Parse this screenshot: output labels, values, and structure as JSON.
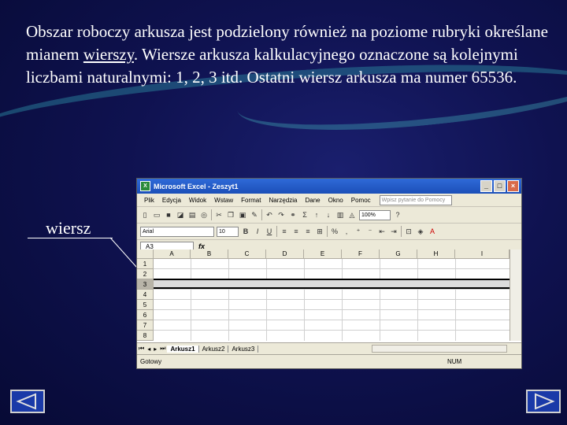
{
  "paragraph": {
    "part1": "Obszar roboczy arkusza jest podzielony również na poziome rubryki określane mianem ",
    "keyword": "wierszy",
    "part2": ". Wiersze arkusza kalkulacyjnego oznaczone są kolejnymi liczbami naturalnymi: 1, 2, 3 itd. Ostatni wiersz arkusza ma numer 65536."
  },
  "callout": {
    "label": "wiersz"
  },
  "excel": {
    "title": "Microsoft Excel - Zeszyt1",
    "menu": [
      "Plik",
      "Edycja",
      "Widok",
      "Wstaw",
      "Format",
      "Narzędzia",
      "Dane",
      "Okno",
      "Pomoc"
    ],
    "help_placeholder": "Wpisz pytanie do Pomocy",
    "zoom": "100%",
    "font_name": "Arial",
    "font_size": "10",
    "name_box": "A3",
    "fx_label": "fx",
    "columns": [
      "A",
      "B",
      "C",
      "D",
      "E",
      "F",
      "G",
      "H",
      "I"
    ],
    "rows": [
      "1",
      "2",
      "3",
      "4",
      "5",
      "6",
      "7",
      "8"
    ],
    "selected_row": "3",
    "sheets": [
      "Arkusz1",
      "Arkusz2",
      "Arkusz3"
    ],
    "active_sheet": "Arkusz1",
    "status_ready": "Gotowy",
    "status_num": "NUM"
  },
  "nav": {
    "prev_icon": "left-triangle-icon",
    "next_icon": "right-triangle-icon"
  },
  "colors": {
    "background": "#0f1250",
    "titlebar": "#2f6ad8",
    "nav_button": "#1a3aa8"
  }
}
